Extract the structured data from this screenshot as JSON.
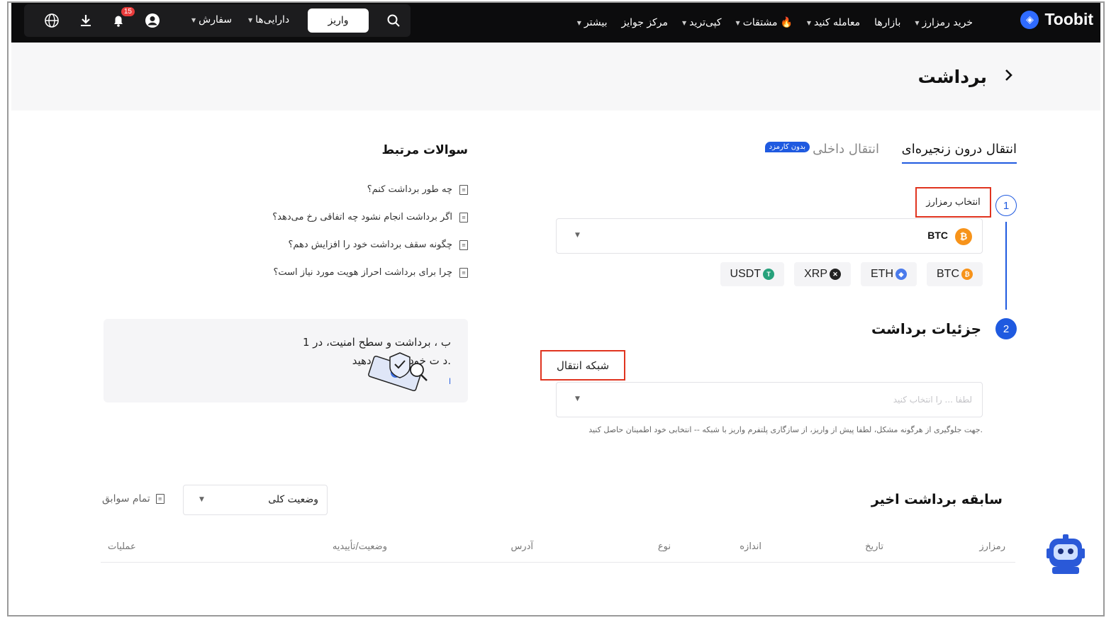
{
  "topbar": {
    "brand": "Toobit",
    "nav": [
      {
        "label": "خرید رمزارز",
        "caret": true
      },
      {
        "label": "بازارها",
        "caret": false
      },
      {
        "label": "معامله کنید",
        "caret": true
      },
      {
        "label": "مشتقات",
        "caret": true,
        "hot": true
      },
      {
        "label": "کپی‌ترید",
        "caret": true
      },
      {
        "label": "مرکز جوایز",
        "caret": false
      },
      {
        "label": "بیشتر",
        "caret": true
      }
    ],
    "deposit_label": "واریز",
    "assets_label": "دارایی‌ها",
    "orders_label": "سفارش",
    "notification_count": "15"
  },
  "header": {
    "title": "برداشت"
  },
  "tabs": {
    "onchain": "انتقال درون زنجیره‌ای",
    "internal": "انتقال داخلی",
    "free_badge": "بدون کارمزد"
  },
  "steps": {
    "step1_number": "1",
    "step1_label": "انتخاب رمزارز",
    "step2_number": "2",
    "step2_label": "جزئیات برداشت"
  },
  "coin_select": {
    "selected": "BTC",
    "quick": [
      "BTC",
      "ETH",
      "XRP",
      "USDT"
    ]
  },
  "network": {
    "label": "شبکه انتقال",
    "placeholder": "لطفا ... را انتخاب کنید",
    "hint": "جهت جلوگیری از هرگونه مشکل، لطفا پیش از واریز، از سازگاری پلتفرم واریز با شبکه -- انتخابی خود اطمینان حاصل کنید."
  },
  "faq": {
    "title": "سوالات مرتبط",
    "items": [
      "چه طور برداشت کنم؟",
      "اگر برداشت انجام نشود چه اتفاقی رخ می‌دهد؟",
      "چگونه سقف برداشت خود را افزایش دهم؟",
      "چرا برای برداشت احراز هویت مورد نیاز است؟"
    ]
  },
  "promo": {
    "line1": "ب ، برداشت و سطح امنیت، در 1",
    "line2": "د ت خود را ارتقا دهید.",
    "link": "ا"
  },
  "history": {
    "title": "سابقه برداشت اخیر",
    "status_filter": "وضعیت کلی",
    "all_records": "تمام سوابق",
    "columns": [
      "رمزارز",
      "تاریخ",
      "اندازه",
      "نوع",
      "آدرس",
      "وضعیت/تأییدیه",
      "عملیات"
    ]
  },
  "colors": {
    "accent": "#1f5ae0",
    "highlight": "#e0341f",
    "topbar": "#0c0c0d"
  }
}
